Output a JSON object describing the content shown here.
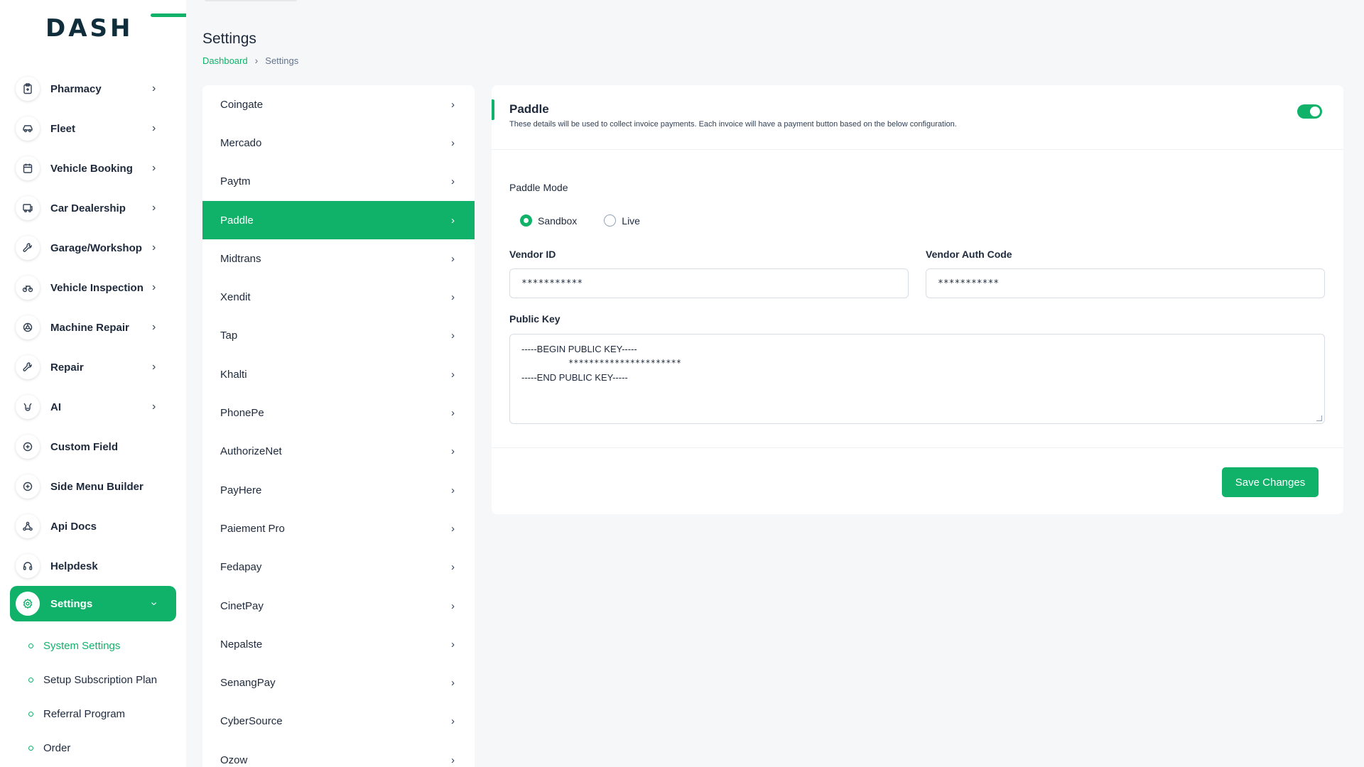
{
  "brand": {
    "logo_text": "DASH",
    "accent": "#10b26a"
  },
  "sidebar": {
    "items": [
      {
        "label": "Pharmacy",
        "icon": "clipboard-icon",
        "has_submenu": true
      },
      {
        "label": "Fleet",
        "icon": "car-icon",
        "has_submenu": true
      },
      {
        "label": "Vehicle Booking",
        "icon": "calendar-icon",
        "has_submenu": true
      },
      {
        "label": "Car Dealership",
        "icon": "dealership-icon",
        "has_submenu": true
      },
      {
        "label": "Garage/Workshop",
        "icon": "wrench-icon",
        "has_submenu": true
      },
      {
        "label": "Vehicle Inspection",
        "icon": "bike-icon",
        "has_submenu": true
      },
      {
        "label": "Machine Repair",
        "icon": "machine-icon",
        "has_submenu": true
      },
      {
        "label": "Repair",
        "icon": "tool-icon",
        "has_submenu": true
      },
      {
        "label": "AI",
        "icon": "ai-icon",
        "has_submenu": true
      },
      {
        "label": "Custom Field",
        "icon": "plus-circle-icon",
        "has_submenu": false
      },
      {
        "label": "Side Menu Builder",
        "icon": "plus-circle-icon",
        "has_submenu": false
      },
      {
        "label": "Api Docs",
        "icon": "api-icon",
        "has_submenu": false
      },
      {
        "label": "Helpdesk",
        "icon": "headset-icon",
        "has_submenu": false
      }
    ],
    "active": {
      "label": "Settings",
      "icon": "gear-icon"
    },
    "sub_items": [
      {
        "label": "System Settings",
        "active": true
      },
      {
        "label": "Setup Subscription Plan",
        "active": false
      },
      {
        "label": "Referral Program",
        "active": false
      },
      {
        "label": "Order",
        "active": false
      }
    ]
  },
  "header": {
    "title": "Settings",
    "breadcrumb": {
      "home": "Dashboard",
      "current": "Settings"
    }
  },
  "gateways": [
    "Coingate",
    "Mercado",
    "Paytm",
    "Paddle",
    "Midtrans",
    "Xendit",
    "Tap",
    "Khalti",
    "PhonePe",
    "AuthorizeNet",
    "PayHere",
    "Paiement Pro",
    "Fedapay",
    "CinetPay",
    "Nepalste",
    "SenangPay",
    "CyberSource",
    "Ozow"
  ],
  "active_gateway": "Paddle",
  "card": {
    "title": "Paddle",
    "description": "These details will be used to collect invoice payments. Each invoice will have a payment button based on the below configuration.",
    "enabled": true,
    "mode_label": "Paddle Mode",
    "modes": [
      {
        "label": "Sandbox",
        "checked": true
      },
      {
        "label": "Live",
        "checked": false
      }
    ],
    "vendor_id_label": "Vendor ID",
    "vendor_id_value": "***********",
    "vendor_auth_label": "Vendor Auth Code",
    "vendor_auth_value": "***********",
    "public_key_label": "Public Key",
    "public_key_lines": [
      "-----BEGIN PUBLIC KEY-----",
      "**********************",
      "-----END PUBLIC KEY-----"
    ],
    "save_label": "Save Changes"
  }
}
